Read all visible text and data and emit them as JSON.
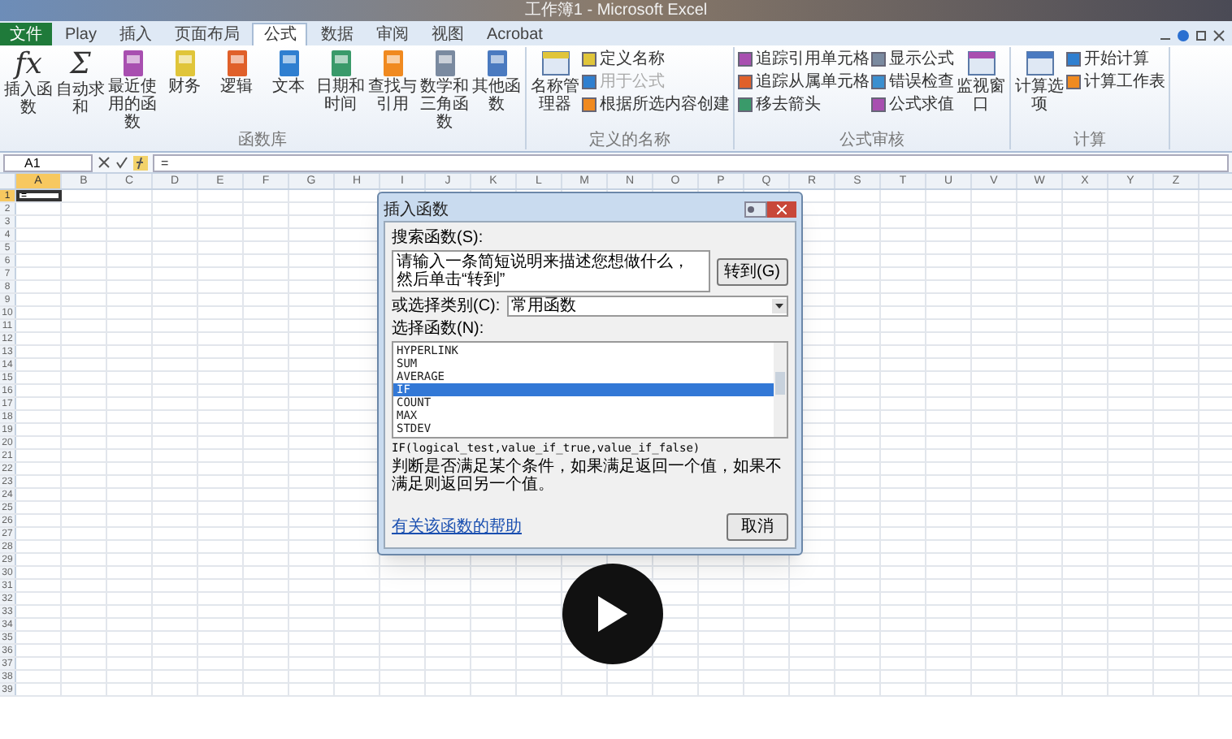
{
  "window": {
    "title": "工作簿1 - Microsoft Excel"
  },
  "tabs": [
    {
      "label": "文件",
      "kind": "file",
      "selected": false
    },
    {
      "label": "Play",
      "kind": "tab",
      "selected": false
    },
    {
      "label": "插入",
      "kind": "tab",
      "selected": false
    },
    {
      "label": "页面布局",
      "kind": "tab",
      "selected": false
    },
    {
      "label": "公式",
      "kind": "tab",
      "selected": true
    },
    {
      "label": "数据",
      "kind": "tab",
      "selected": false
    },
    {
      "label": "审阅",
      "kind": "tab",
      "selected": false
    },
    {
      "label": "视图",
      "kind": "tab",
      "selected": false
    },
    {
      "label": "Acrobat",
      "kind": "tab",
      "selected": false
    }
  ],
  "ribbon": [
    {
      "label": "函数库",
      "items": [
        {
          "kind": "large",
          "label": "插入函数",
          "glyph": "fx"
        },
        {
          "kind": "large",
          "label": "自动求和",
          "glyph": "Σ"
        },
        {
          "kind": "large",
          "label": "最近使用的函数"
        },
        {
          "kind": "large",
          "label": "财务"
        },
        {
          "kind": "large",
          "label": "逻辑"
        },
        {
          "kind": "large",
          "label": "文本"
        },
        {
          "kind": "large",
          "label": "日期和时间"
        },
        {
          "kind": "large",
          "label": "查找与引用"
        },
        {
          "kind": "large",
          "label": "数学和三角函数"
        },
        {
          "kind": "large",
          "label": "其他函数"
        }
      ]
    },
    {
      "label": "定义的名称",
      "items": [
        {
          "kind": "large",
          "label": "名称管理器"
        },
        {
          "kind": "small",
          "label": "定义名称"
        },
        {
          "kind": "small",
          "label": "用于公式",
          "disabled": true
        },
        {
          "kind": "small",
          "label": "根据所选内容创建"
        }
      ]
    },
    {
      "label": "公式审核",
      "items": [
        {
          "kind": "small",
          "label": "追踪引用单元格"
        },
        {
          "kind": "small",
          "label": "追踪从属单元格"
        },
        {
          "kind": "small",
          "label": "移去箭头"
        },
        {
          "kind": "small",
          "label": "显示公式"
        },
        {
          "kind": "small",
          "label": "错误检查"
        },
        {
          "kind": "small",
          "label": "公式求值"
        },
        {
          "kind": "large",
          "label": "监视窗口"
        }
      ]
    },
    {
      "label": "计算",
      "items": [
        {
          "kind": "large",
          "label": "计算选项"
        },
        {
          "kind": "small",
          "label": "开始计算"
        },
        {
          "kind": "small",
          "label": "计算工作表"
        }
      ]
    }
  ],
  "formula_bar": {
    "name_box": "A1",
    "value": "="
  },
  "sheet": {
    "columns": [
      "A",
      "B",
      "C",
      "D",
      "E",
      "F",
      "G",
      "H",
      "I",
      "J",
      "K",
      "L",
      "M",
      "N",
      "O",
      "P",
      "Q",
      "R",
      "S",
      "T",
      "U",
      "V",
      "W",
      "X",
      "Y",
      "Z"
    ],
    "rows": [
      "1",
      "2",
      "3",
      "4",
      "5",
      "6",
      "7",
      "8",
      "9",
      "10",
      "11",
      "12",
      "13",
      "14",
      "15",
      "16",
      "17",
      "18",
      "19",
      "20",
      "21",
      "22",
      "23",
      "24",
      "25",
      "26",
      "27",
      "28",
      "29",
      "30",
      "31",
      "32",
      "33",
      "34",
      "35",
      "36",
      "37",
      "38",
      "39"
    ],
    "active_cell": {
      "value": "="
    }
  },
  "dialog": {
    "title": "插入函数",
    "search_label": "搜索函数(S):",
    "search_value": "请输入一条简短说明来描述您想做什么，然后单击“转到”",
    "go_button": "转到(G)",
    "category_label": "或选择类别(C):",
    "category_value": "常用函数",
    "list_label": "选择函数(N):",
    "functions": [
      {
        "name": "HYPERLINK",
        "selected": false
      },
      {
        "name": "SUM",
        "selected": false
      },
      {
        "name": "AVERAGE",
        "selected": false
      },
      {
        "name": "IF",
        "selected": true
      },
      {
        "name": "COUNT",
        "selected": false
      },
      {
        "name": "MAX",
        "selected": false
      },
      {
        "name": "STDEV",
        "selected": false
      }
    ],
    "signature": "IF(logical_test,value_if_true,value_if_false)",
    "description": "判断是否满足某个条件，如果满足返回一个值，如果不满足则返回另一个值。",
    "help_link": "有关该函数的帮助",
    "cancel_button": "取消"
  }
}
